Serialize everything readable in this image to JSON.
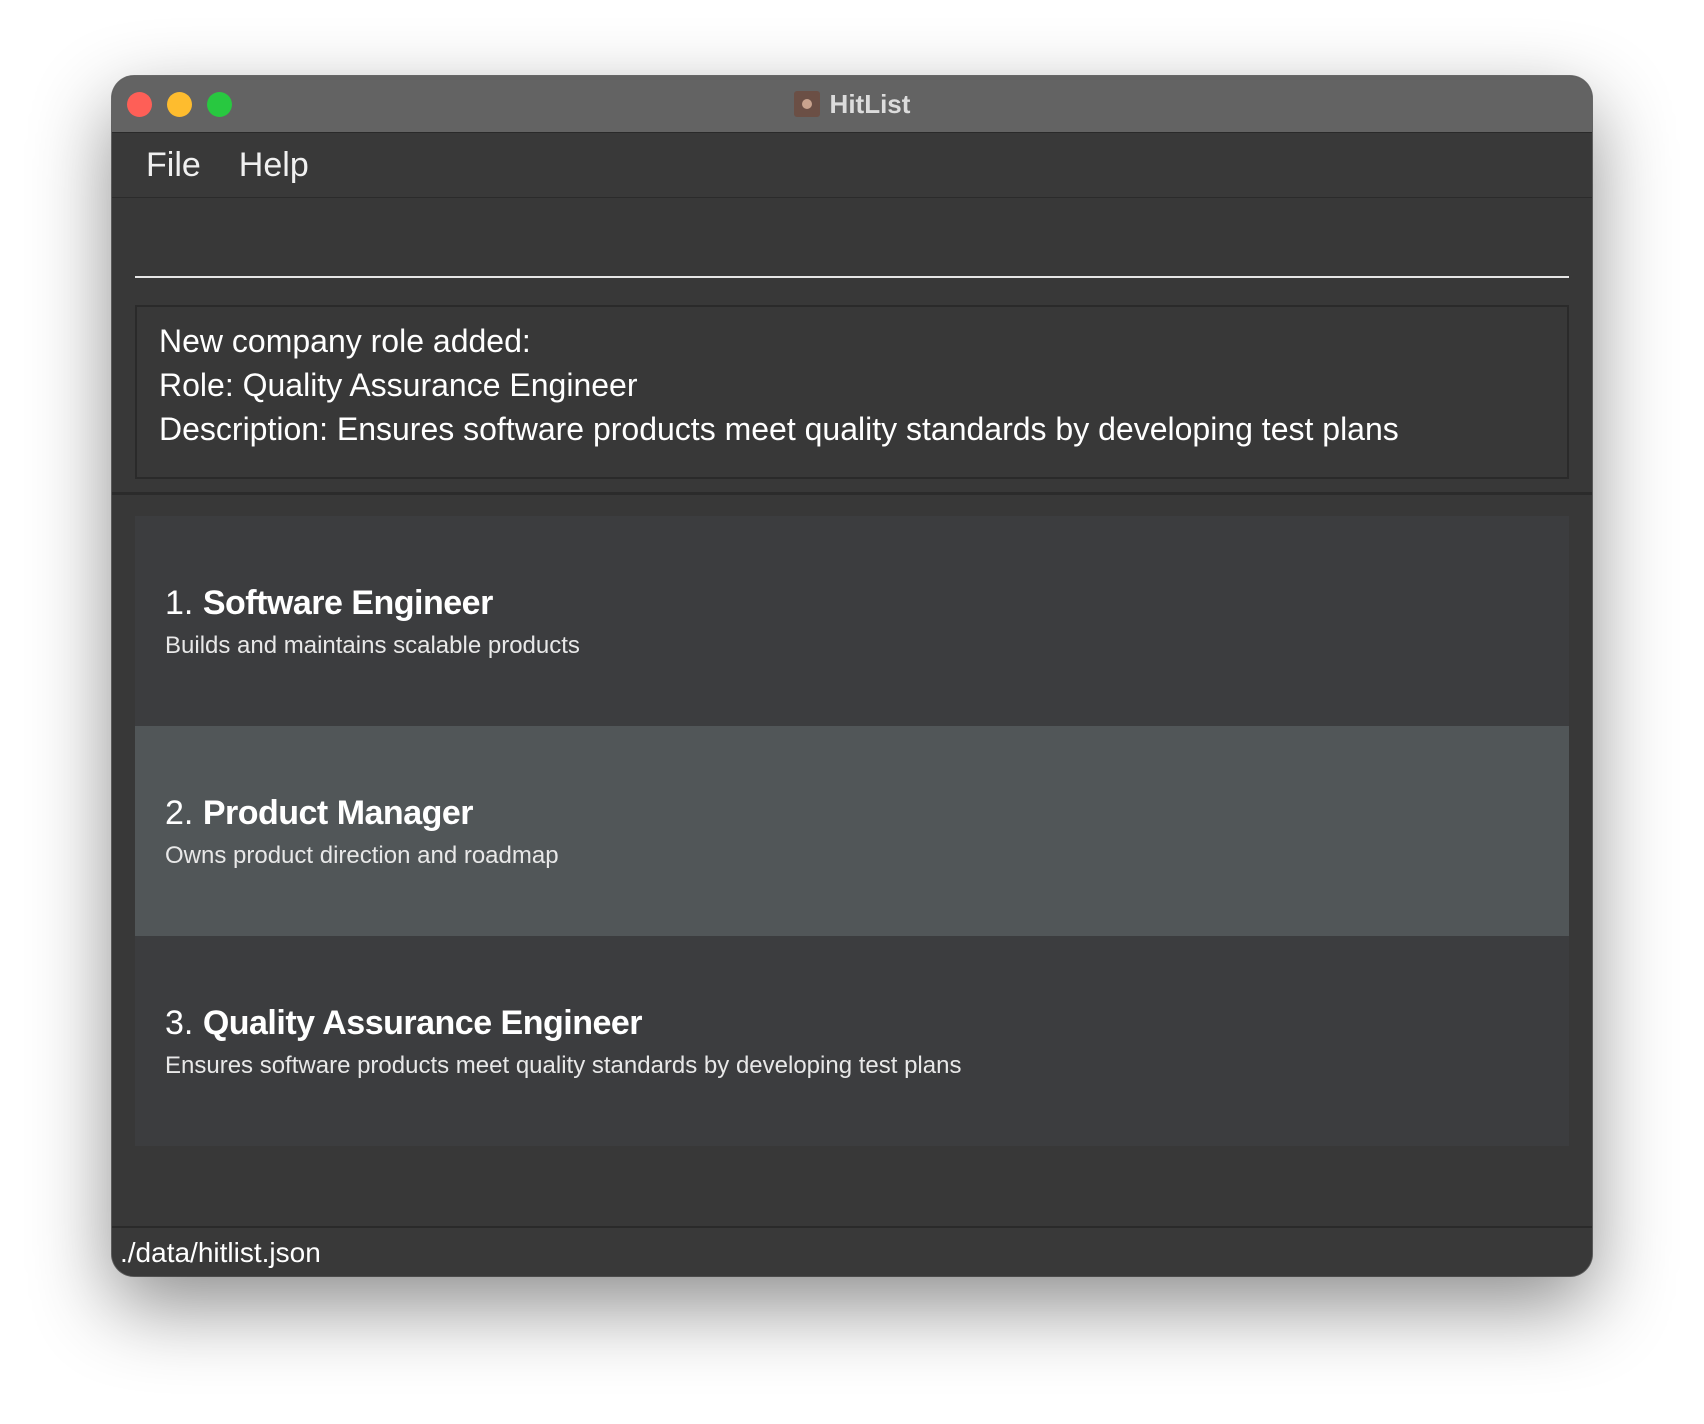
{
  "window": {
    "title": "HitList",
    "controls": [
      "close",
      "minimize",
      "maximize"
    ],
    "app_icon": "hitlist-app-icon"
  },
  "menu": {
    "items": [
      {
        "label": "File"
      },
      {
        "label": "Help"
      }
    ]
  },
  "command": {
    "value": "",
    "placeholder": ""
  },
  "result": {
    "lines": [
      "New company role added:",
      "Role: Quality Assurance Engineer",
      "Description: Ensures software products meet quality standards by developing test plans"
    ]
  },
  "roles": [
    {
      "index": "1.",
      "name": "Software Engineer",
      "description": "Builds and maintains scalable products",
      "selected": false
    },
    {
      "index": "2.",
      "name": "Product Manager",
      "description": "Owns product direction and roadmap",
      "selected": true
    },
    {
      "index": "3.",
      "name": "Quality Assurance Engineer",
      "description": "Ensures software products meet quality standards by developing test plans",
      "selected": false
    }
  ],
  "status": {
    "path": "./data/hitlist.json"
  },
  "colors": {
    "close": "#fe5f57",
    "minimize": "#febc2e",
    "maximize": "#28c840",
    "card": "#3c3d3f",
    "card_selected": "#515658",
    "background": "#383838"
  }
}
